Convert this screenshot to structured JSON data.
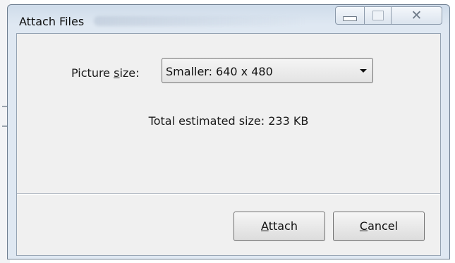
{
  "window": {
    "title": "Attach Files",
    "close_glyph": "✕"
  },
  "picture_size": {
    "label_prefix": "Picture ",
    "label_accel": "s",
    "label_suffix": "ize:",
    "selected": "Smaller: 640 x 480"
  },
  "total_estimated_size": "Total estimated size: 233 KB",
  "buttons": {
    "attach": {
      "accel": "A",
      "rest": "ttach"
    },
    "cancel": {
      "accel": "C",
      "rest": "ancel"
    }
  },
  "icons": {
    "minimize": "minimize-icon",
    "maximize": "maximize-icon",
    "close": "close-icon",
    "dropdown": "chevron-down-icon"
  }
}
